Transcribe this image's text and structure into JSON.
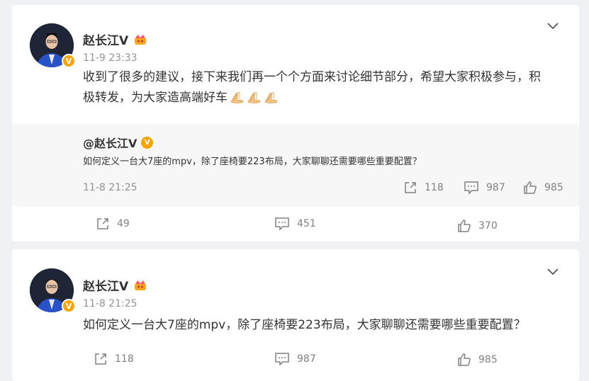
{
  "posts": [
    {
      "author": "赵长江V",
      "time": "11-9 23:33",
      "content": "收到了很多的建议，接下来我们再一个个方面来讨论细节部分，希望大家积极参与，积极转发，为大家造高端好车",
      "content_line1": "收到了很多的建议，接下来我们再一个个方面来讨论细节部分，希望大家积极参与，积",
      "content_line2": "极转发，为大家造高端好车",
      "emojis": [
        "pray-hands-icon",
        "pray-hands-icon",
        "pray-hands-icon"
      ],
      "repost": {
        "author": "@赵长江V",
        "text": "如何定义一台大7座的mpv，除了座椅要223布局，大家聊聊还需要哪些重要配置？",
        "time": "11-8 21:25",
        "shares": "118",
        "comments": "987",
        "likes": "985"
      },
      "stats": {
        "shares": "49",
        "comments": "451",
        "likes": "370"
      }
    },
    {
      "author": "赵长江V",
      "time": "11-8 21:25",
      "content": "如何定义一台大7座的mpv，除了座椅要223布局，大家聊聊还需要哪些重要配置？",
      "stats": {
        "shares": "118",
        "comments": "987",
        "likes": "985"
      }
    }
  ],
  "badge_letter": "V",
  "colors": {
    "background": "#f0f1f4",
    "card": "#ffffff",
    "repost_bg": "#f7f7f8",
    "verified": "#f7a400",
    "meta": "#939393",
    "icon": "#808080"
  }
}
